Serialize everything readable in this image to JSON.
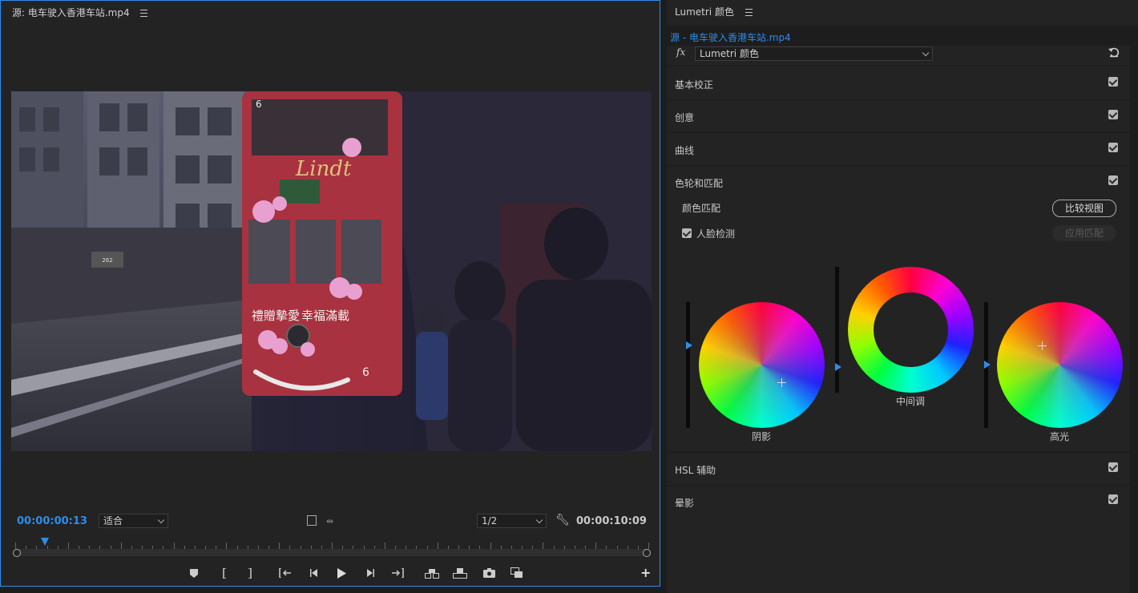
{
  "source_monitor": {
    "title": "源: 电车驶入香港车站.mp4",
    "current_timecode": "00:00:00:13",
    "zoom_label": "适合",
    "resolution_label": "1/2",
    "duration_timecode": "00:00:10:09",
    "playhead_fraction": 0.047,
    "video": {
      "tram_text_brand": "Lindt",
      "tram_text_slogan1": "禮贈摯愛",
      "tram_text_slogan2": "幸福滿載",
      "tram_number": "6",
      "shop_number": "262"
    }
  },
  "lumetri": {
    "title": "Lumetri 颜色",
    "source_tab": "源 - 电车驶入香港车站.mp4",
    "fx_label": "fx",
    "effect_name": "Lumetri 颜色",
    "sections": {
      "basic": "基本校正",
      "creative": "创意",
      "curves": "曲线",
      "wheels": "色轮和匹配",
      "hsl": "HSL 辅助",
      "vignette": "晕影"
    },
    "color_match_label": "颜色匹配",
    "compare_view_button": "比较视图",
    "face_detect_label": "人脸检测",
    "apply_match_button": "应用匹配",
    "wheels": {
      "shadows": "阴影",
      "midtones": "中间调",
      "highlights": "高光"
    }
  },
  "colors": {
    "accent": "#2d8ceb",
    "panel_bg": "#232323"
  }
}
